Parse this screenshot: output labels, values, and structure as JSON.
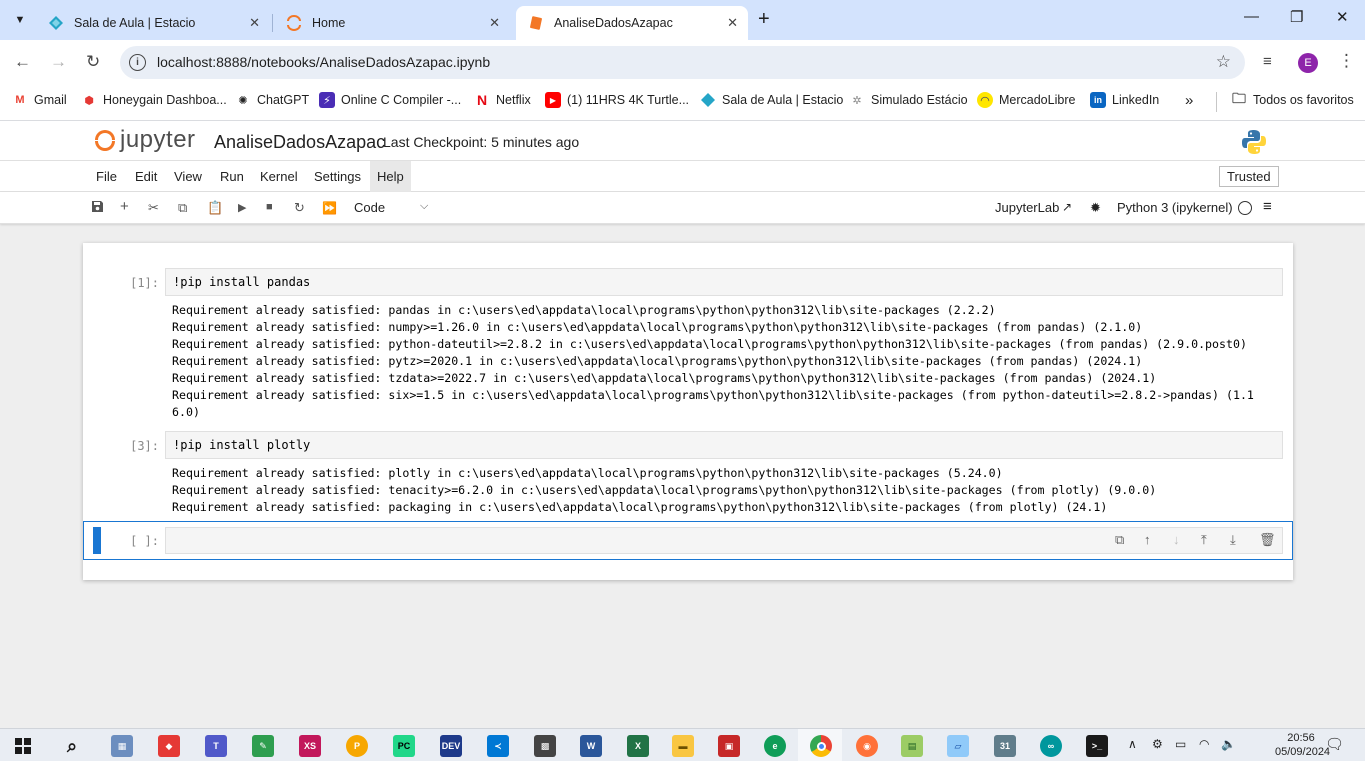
{
  "browser": {
    "tabs": [
      {
        "title": "Sala de Aula | Estacio",
        "icon": "estacio-diamond-icon",
        "active": false
      },
      {
        "title": "Home",
        "icon": "jupyter-icon",
        "active": false
      },
      {
        "title": "AnaliseDadosAzapac",
        "icon": "jupyter-notebook-icon",
        "active": true
      }
    ],
    "url": "localhost:8888/notebooks/AnaliseDadosAzapac.ipynb",
    "profile_initial": "E",
    "bookmarks": [
      {
        "label": "Gmail",
        "icon": "gmail-icon"
      },
      {
        "label": "Honeygain Dashboa...",
        "icon": "honeygain-icon"
      },
      {
        "label": "ChatGPT",
        "icon": "chatgpt-icon"
      },
      {
        "label": "Online C Compiler -...",
        "icon": "compiler-icon"
      },
      {
        "label": "Netflix",
        "icon": "netflix-icon"
      },
      {
        "label": "(1) 11HRS 4K Turtle...",
        "icon": "youtube-icon"
      },
      {
        "label": "Sala de Aula | Estacio",
        "icon": "estacio-icon"
      },
      {
        "label": "Simulado Estácio",
        "icon": "simulado-icon"
      },
      {
        "label": "MercadoLibre",
        "icon": "mercadolibre-icon"
      },
      {
        "label": "LinkedIn",
        "icon": "linkedin-icon"
      }
    ],
    "all_bookmarks_label": "Todos os favoritos"
  },
  "jupyter": {
    "logo_text": "jupyter",
    "notebook_title": "AnaliseDadosAzapac",
    "checkpoint": "Last Checkpoint: 5 minutes ago",
    "menu": [
      "File",
      "Edit",
      "View",
      "Run",
      "Kernel",
      "Settings",
      "Help"
    ],
    "trusted_label": "Trusted",
    "cell_type": "Code",
    "jupyterlab_label": "JupyterLab",
    "kernel_name": "Python 3 (ipykernel)"
  },
  "cells": [
    {
      "prompt": "[1]:",
      "source": "!pip install pandas",
      "output": [
        "Requirement already satisfied: pandas in c:\\users\\ed\\appdata\\local\\programs\\python\\python312\\lib\\site-packages (2.2.2)",
        "Requirement already satisfied: numpy>=1.26.0 in c:\\users\\ed\\appdata\\local\\programs\\python\\python312\\lib\\site-packages (from pandas) (2.1.0)",
        "Requirement already satisfied: python-dateutil>=2.8.2 in c:\\users\\ed\\appdata\\local\\programs\\python\\python312\\lib\\site-packages (from pandas) (2.9.0.post0)",
        "Requirement already satisfied: pytz>=2020.1 in c:\\users\\ed\\appdata\\local\\programs\\python\\python312\\lib\\site-packages (from pandas) (2024.1)",
        "Requirement already satisfied: tzdata>=2022.7 in c:\\users\\ed\\appdata\\local\\programs\\python\\python312\\lib\\site-packages (from pandas) (2024.1)",
        "Requirement already satisfied: six>=1.5 in c:\\users\\ed\\appdata\\local\\programs\\python\\python312\\lib\\site-packages (from python-dateutil>=2.8.2->pandas) (1.1",
        "6.0)"
      ]
    },
    {
      "prompt": "[3]:",
      "source": "!pip install plotly",
      "output": [
        "Requirement already satisfied: plotly in c:\\users\\ed\\appdata\\local\\programs\\python\\python312\\lib\\site-packages (5.24.0)",
        "Requirement already satisfied: tenacity>=6.2.0 in c:\\users\\ed\\appdata\\local\\programs\\python\\python312\\lib\\site-packages (from plotly) (9.0.0)",
        "Requirement already satisfied: packaging in c:\\users\\ed\\appdata\\local\\programs\\python\\python312\\lib\\site-packages (from plotly) (24.1)"
      ]
    },
    {
      "prompt": "[ ]:",
      "source": "",
      "output": []
    }
  ],
  "taskbar": {
    "time": "20:56",
    "date": "05/09/2024"
  },
  "colors": {
    "jupyter_orange": "#f37726",
    "active_cell_blue": "#1976d2",
    "tabstrip_blue": "#d3e3fd"
  }
}
